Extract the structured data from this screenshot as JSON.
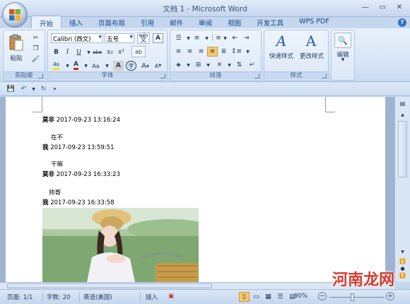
{
  "window": {
    "title": "文档 1 - Microsoft Word"
  },
  "tabs": [
    "开始",
    "插入",
    "页面布局",
    "引用",
    "邮件",
    "审阅",
    "视图",
    "开发工具",
    "WPS PDF"
  ],
  "ribbon": {
    "clipboard": {
      "label": "剪贴板",
      "paste_label": "粘贴"
    },
    "font": {
      "label": "字体",
      "font_name": "Calibri (西文)",
      "font_size": "五号",
      "wen_glyph": "wén\n文",
      "a_glyph": "A"
    },
    "paragraph": {
      "label": "段落"
    },
    "styles": {
      "label": "样式",
      "quick_styles_label": "快速样式",
      "change_styles_label": "更改样式"
    },
    "editing": {
      "label": "编辑"
    }
  },
  "document": {
    "messages": [
      {
        "sender": "莫非",
        "timestamp": "2017-09-23 13:16:24",
        "text": "在不"
      },
      {
        "sender": "我",
        "timestamp": "2017-09-23 13:59:51",
        "text": "干嘛"
      },
      {
        "sender": "莫非",
        "timestamp": "2017-09-23 16:33:23",
        "text": "帅哥"
      },
      {
        "sender": "我",
        "timestamp": "2017-09-23 16:33:58",
        "text": ""
      }
    ]
  },
  "statusbar": {
    "page": "页面: 1/1",
    "words": "字数: 20",
    "language": "英语(美国)",
    "insert_mode": "插入",
    "zoom": "90%"
  },
  "watermark": "河南龙网",
  "colors": {
    "ribbon_bg": "#dce8f7",
    "accent": "#15428b",
    "watermark": "#d63a2e"
  }
}
